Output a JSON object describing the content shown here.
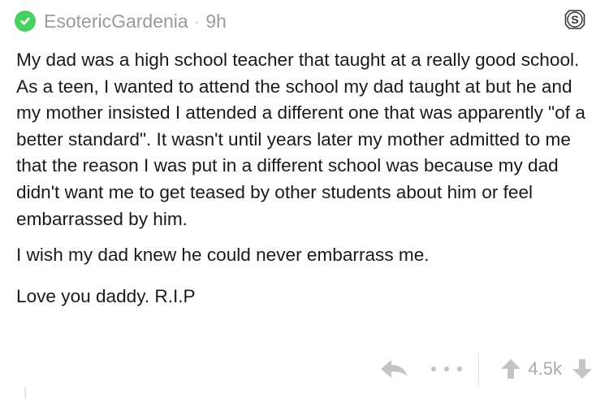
{
  "comment": {
    "author": "EsotericGardenia",
    "separator": "·",
    "time": "9h",
    "paragraphs": [
      "My dad was a high school teacher that taught at a really good school. As a teen, I wanted to attend the school my dad taught at but he and my mother insisted I attended a different one that was apparently \"of a better standard\". It wasn't until years later my mother admitted to me that the reason I was put in a different school was because my dad didn't want me to get teased by other students about him or feel embarrassed by him.",
      "I wish my dad knew he could never embarrass me.",
      "Love you daddy. R.I.P"
    ],
    "score": "4.5k",
    "badge_letter": "S",
    "badge_icon": "award-badge-icon"
  },
  "icons": {
    "verified": "check-circle-icon",
    "reply": "reply-arrow-icon",
    "more": "more-dots-icon",
    "upvote": "upvote-arrow-icon",
    "downvote": "downvote-arrow-icon"
  },
  "colors": {
    "verified_green": "#46d160",
    "meta_gray": "#9a9a9a",
    "icon_gray": "#c4c4c4",
    "text": "#1a1a1b"
  }
}
